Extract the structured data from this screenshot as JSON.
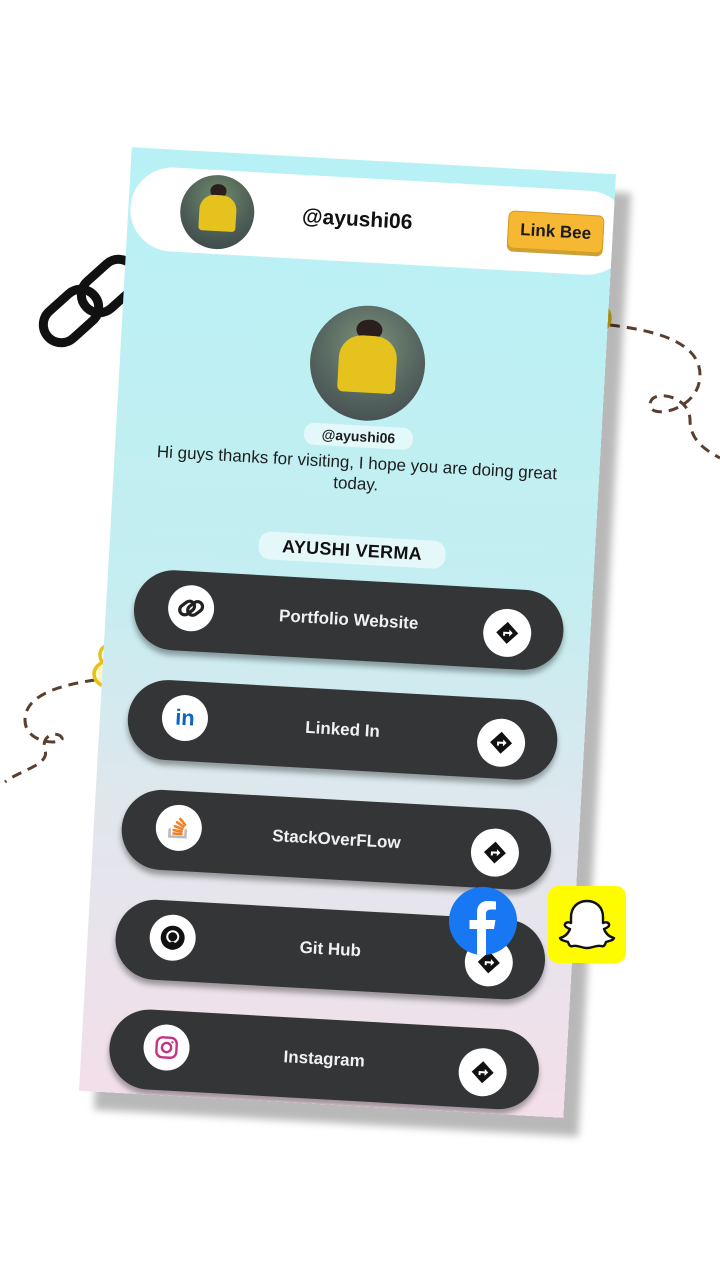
{
  "header": {
    "handle": "@ayushi06",
    "brand_button": "Link Bee"
  },
  "profile": {
    "handle": "@ayushi06",
    "bio": "Hi guys thanks for visiting, I hope you are doing great today.",
    "name": "AYUSHI VERMA"
  },
  "links": [
    {
      "label": "Portfolio Website",
      "icon": "link-icon"
    },
    {
      "label": "Linked In",
      "icon": "linkedin-icon"
    },
    {
      "label": "StackOverFLow",
      "icon": "stackoverflow-icon"
    },
    {
      "label": "Git Hub",
      "icon": "github-icon"
    },
    {
      "label": "Instagram",
      "icon": "instagram-icon"
    }
  ],
  "floating": {
    "facebook": "facebook-icon",
    "snapchat": "snapchat-icon"
  },
  "colors": {
    "accent": "#f6b833",
    "link_bg": "#333536",
    "bg_top": "#b8f1f5",
    "bg_bottom": "#f3dfea",
    "facebook": "#1877f2",
    "snapchat": "#fffc00"
  }
}
